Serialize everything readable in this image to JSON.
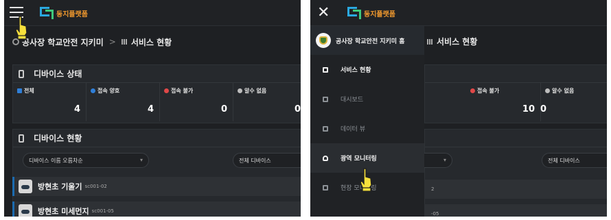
{
  "app": {
    "logo_text": "동지플랫폼"
  },
  "left": {
    "breadcrumb": {
      "root": "공사장 학교안전 지키미",
      "current": "서비스 현황"
    },
    "device_status": {
      "title": "디바이스 상태",
      "stats": [
        {
          "label": "전체",
          "value": "4",
          "color": "#2f7fd8"
        },
        {
          "label": "접속 양호",
          "value": "4",
          "color": "#2f7fd8"
        },
        {
          "label": "접속 불가",
          "value": "0",
          "color": "#e04848"
        },
        {
          "label": "알수 없음",
          "value": "0",
          "color": "#bdbdbd"
        }
      ]
    },
    "device_list": {
      "title": "디바이스 현황",
      "sort_select": "디바이스 이름 오름차순",
      "filter_select": "전체 디바이스",
      "items": [
        {
          "name": "방현초 기울기",
          "code": "sc001-02"
        },
        {
          "name": "방현초 미세먼지",
          "code": "sc001-05"
        }
      ]
    }
  },
  "right": {
    "breadcrumb_current": "서비스 현황",
    "stats": [
      {
        "label": "접속 불가",
        "value": "10",
        "color": "#e04848"
      },
      {
        "label": "알수 없음",
        "value": "0",
        "color": "#bdbdbd"
      }
    ],
    "filter_select": "전체 디바이스",
    "partial_code": "2",
    "partial_code_2": "-05",
    "menu": {
      "header": "공사장 학교안전 지키미 홈",
      "items": [
        {
          "label": "서비스 현황"
        },
        {
          "label": "대시보드"
        },
        {
          "label": "데이터 뷰"
        },
        {
          "label": "광역 모니터링"
        },
        {
          "label": "현장 모니터링"
        }
      ]
    }
  },
  "icons": [
    "hamburger-icon",
    "close-icon",
    "pointer-hand-icon",
    "shield-icon"
  ]
}
